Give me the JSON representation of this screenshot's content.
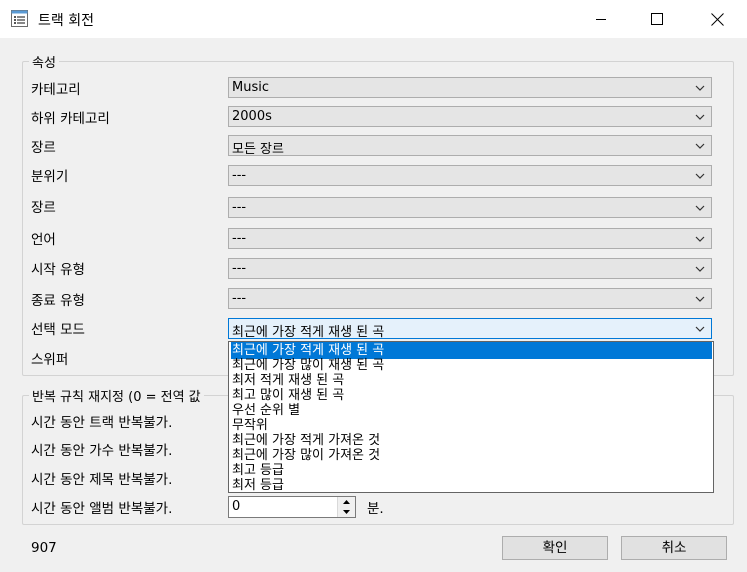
{
  "window": {
    "title": "트랙 회전"
  },
  "properties": {
    "group_title": "속성",
    "rows": [
      {
        "label": "카테고리",
        "value": "Music"
      },
      {
        "label": "하위 카테고리",
        "value": "2000s"
      },
      {
        "label": "장르",
        "value": "모든 장르"
      },
      {
        "label": "분위기",
        "value": "---"
      },
      {
        "label": "장르",
        "value": "---"
      },
      {
        "label": "언어",
        "value": "---"
      },
      {
        "label": "시작 유형",
        "value": "---"
      },
      {
        "label": "종료 유형",
        "value": "---"
      },
      {
        "label": "선택 모드",
        "value": "최근에 가장 적게 재생 된 곡"
      }
    ],
    "sweeper_label": "스위퍼"
  },
  "select_mode_dropdown": {
    "options": [
      "최근에 가장 적게 재생 된 곡",
      "최근에 가장 많이 재생 된 곡",
      "최저 적게 재생 된 곡",
      "최고 많이 재생 된 곡",
      "우선 순위 별",
      "무작위",
      "최근에 가장 적게 가져온 것",
      "최근에 가장 많이 가져온 것",
      "최고 등급",
      "최저 등급"
    ],
    "selected_index": 0
  },
  "repeat_rules": {
    "group_title": "반복 규칙 재지정 (0 = 전역 값",
    "rows": [
      {
        "label": "시간 동안 트랙 반복불가."
      },
      {
        "label": "시간 동안 가수 반복불가."
      },
      {
        "label": "시간 동안 제목 반복불가."
      },
      {
        "label": "시간 동안 앨범 반복불가."
      }
    ],
    "album_value": "0",
    "album_unit": "분."
  },
  "footer": {
    "id_text": "907",
    "ok_label": "확인",
    "cancel_label": "취소"
  }
}
